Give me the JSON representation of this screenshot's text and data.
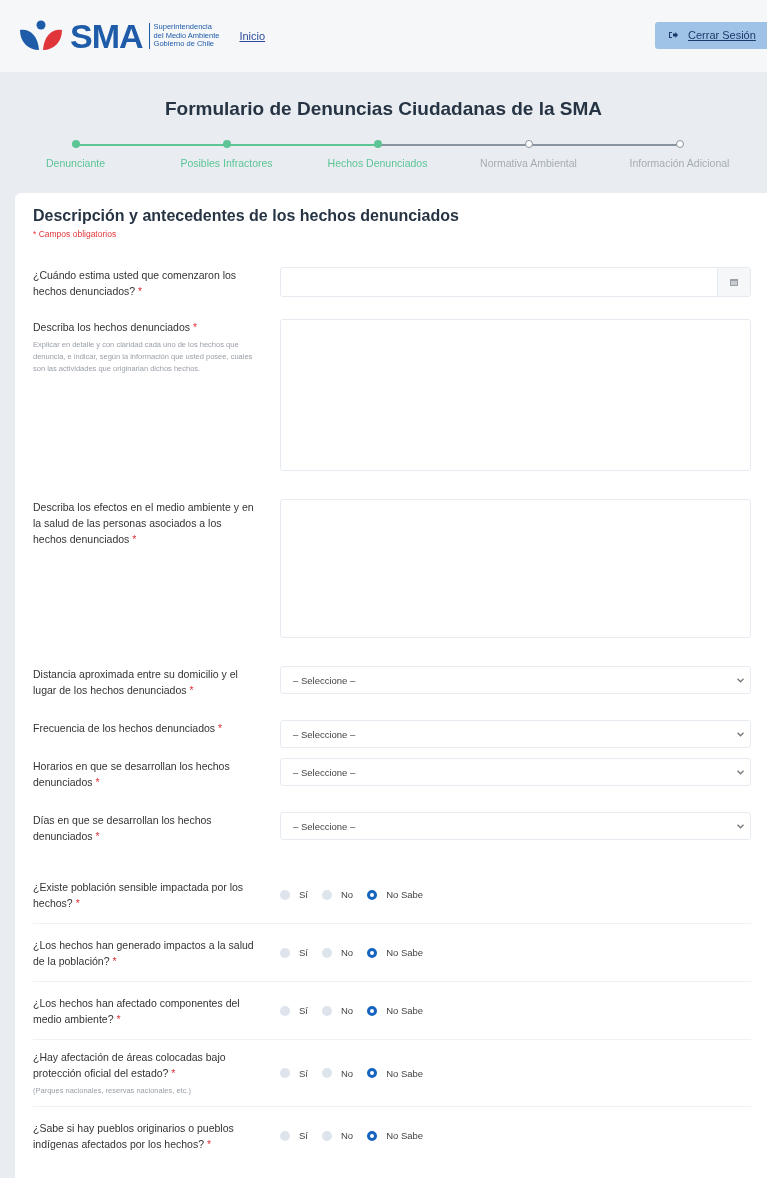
{
  "header": {
    "logo_text": "SMA",
    "logo_sub": [
      "Superintendencia",
      "del Medio Ambiente",
      "Gobierno de Chile"
    ],
    "nav_link": "Inicio",
    "logout": "Cerrar Sesión"
  },
  "title": "Formulario de Denuncias Ciudadanas de la SMA",
  "steps": [
    {
      "label": "Denunciante",
      "completed": true
    },
    {
      "label": "Posibles Infractores",
      "completed": true
    },
    {
      "label": "Hechos Denunciados",
      "completed": true
    },
    {
      "label": "Normativa Ambiental",
      "completed": false
    },
    {
      "label": "Información Adicional",
      "completed": false
    }
  ],
  "section": {
    "title": "Descripción y antecedentes de los hechos denunciados",
    "required_note": "* Campos obligatorios"
  },
  "fields": [
    {
      "kind": "date",
      "label": "¿Cuándo estima usted que comenzaron los hechos denunciados?",
      "required_mark": "*"
    },
    {
      "kind": "textarea",
      "label": "Describa los hechos denunciados",
      "required_mark": "*",
      "help": "Explicar en detalle y con claridad cada uno de los hechos que denuncia, e indicar, según la información que usted posee, cuales son las actividades que originarian dichos hechos."
    },
    {
      "kind": "textarea",
      "label": "Describa los efectos en el medio ambiente y en la salud de las personas asociados a los hechos denunciados",
      "required_mark": "*"
    },
    {
      "kind": "select",
      "label": "Distancia aproximada entre su domicilio y el lugar de los hechos denunciados",
      "required_mark": "*",
      "value": "– Seleccione –"
    },
    {
      "kind": "select",
      "label": "Frecuencia de los hechos denunciados",
      "required_mark": "*",
      "value": "– Seleccione –"
    },
    {
      "kind": "select",
      "label": "Horarios en que se desarrollan los hechos denunciados",
      "required_mark": "*",
      "value": "– Seleccione –"
    },
    {
      "kind": "select",
      "label": "Días en que se desarrollan los hechos denunciados",
      "required_mark": "*",
      "value": "– Seleccione –"
    },
    {
      "kind": "radio",
      "label": "¿Existe población sensible impactada por los hechos?",
      "required_mark": "*",
      "options": [
        {
          "label": "Sí",
          "selected": false
        },
        {
          "label": "No",
          "selected": false
        },
        {
          "label": "No Sabe",
          "selected": true
        }
      ]
    },
    {
      "kind": "radio",
      "label": "¿Los hechos han generado impactos a la salud de la población?",
      "required_mark": "*",
      "options": [
        {
          "label": "Sí",
          "selected": false
        },
        {
          "label": "No",
          "selected": false
        },
        {
          "label": "No Sabe",
          "selected": true
        }
      ]
    },
    {
      "kind": "radio",
      "label": "¿Los hechos han afectado componentes del medio ambiente?",
      "required_mark": "*",
      "options": [
        {
          "label": "Sí",
          "selected": false
        },
        {
          "label": "No",
          "selected": false
        },
        {
          "label": "No Sabe",
          "selected": true
        }
      ]
    },
    {
      "kind": "radio",
      "label": "¿Hay afectación de áreas colocadas bajo protección oficial del estado?",
      "required_mark": "*",
      "help": "(Parques nacionales, reservas nacionales, etc.)",
      "options": [
        {
          "label": "Sí",
          "selected": false
        },
        {
          "label": "No",
          "selected": false
        },
        {
          "label": "No Sabe",
          "selected": true
        }
      ]
    },
    {
      "kind": "radio",
      "label": "¿Sabe si hay pueblos originarios o pueblos indígenas afectados por los hechos?",
      "required_mark": "*",
      "options": [
        {
          "label": "Sí",
          "selected": false
        },
        {
          "label": "No",
          "selected": false
        },
        {
          "label": "No Sabe",
          "selected": true
        }
      ]
    }
  ]
}
